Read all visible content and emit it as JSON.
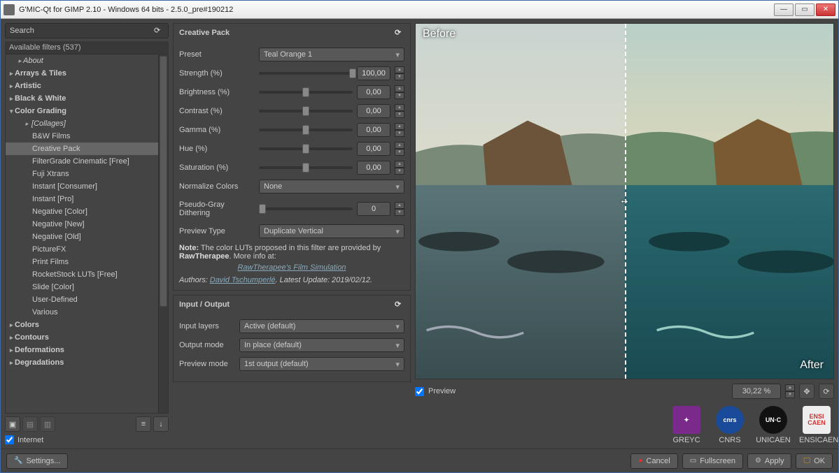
{
  "title": "G'MIC-Qt for GIMP 2.10 - Windows 64 bits - 2.5.0_pre#190212",
  "search_placeholder": "Search",
  "tree_header": "Available filters (537)",
  "tree": {
    "about": "About",
    "cats": [
      "Arrays & Tiles",
      "Artistic",
      "Black & White"
    ],
    "open_cat": "Color Grading",
    "sub_italic": "[Collages]",
    "subs": [
      "B&W Films",
      "Creative Pack",
      "FilterGrade Cinematic [Free]",
      "Fuji Xtrans",
      "Instant [Consumer]",
      "Instant [Pro]",
      "Negative [Color]",
      "Negative [New]",
      "Negative [Old]",
      "PictureFX",
      "Print Films",
      "RocketStock LUTs [Free]",
      "Slide [Color]",
      "User-Defined",
      "Various"
    ],
    "selected": "Creative Pack",
    "cats_after": [
      "Colors",
      "Contours",
      "Deformations",
      "Degradations"
    ]
  },
  "internet_label": "Internet",
  "panel1": {
    "title": "Creative Pack",
    "preset_label": "Preset",
    "preset_value": "Teal Orange 1",
    "sliders": [
      {
        "label": "Strength (%)",
        "value": "100,00",
        "pos": 100
      },
      {
        "label": "Brightness (%)",
        "value": "0,00",
        "pos": 50
      },
      {
        "label": "Contrast (%)",
        "value": "0,00",
        "pos": 50
      },
      {
        "label": "Gamma (%)",
        "value": "0,00",
        "pos": 50
      },
      {
        "label": "Hue (%)",
        "value": "0,00",
        "pos": 50
      },
      {
        "label": "Saturation (%)",
        "value": "0,00",
        "pos": 50
      }
    ],
    "normalize_label": "Normalize Colors",
    "normalize_value": "None",
    "pseudo_label": "Pseudo-Gray Dithering",
    "pseudo_value": "0",
    "preview_type_label": "Preview Type",
    "preview_type_value": "Duplicate Vertical",
    "note1": "Note:",
    "note2": "The color LUTs proposed in this filter are provided by",
    "note3": "RawTherapee",
    "note4": ". More info at:",
    "link": "RawTherapee's Film Simulation",
    "authors_label": "Authors:",
    "authors_name": "David Tschumperlé",
    "latest": ". Latest Update:",
    "latest_date": "2019/02/12."
  },
  "panel2": {
    "title": "Input / Output",
    "rows": [
      {
        "label": "Input layers",
        "value": "Active (default)"
      },
      {
        "label": "Output mode",
        "value": "In place (default)"
      },
      {
        "label": "Preview mode",
        "value": "1st output (default)"
      }
    ]
  },
  "preview": {
    "before": "Before",
    "after": "After",
    "checkbox": "Preview",
    "zoom": "30,22 %"
  },
  "logos": [
    "GREYC",
    "CNRS",
    "UNICAEN",
    "ENSICAEN"
  ],
  "footer": {
    "settings": "Settings...",
    "cancel": "Cancel",
    "fullscreen": "Fullscreen",
    "apply": "Apply",
    "ok": "OK"
  }
}
